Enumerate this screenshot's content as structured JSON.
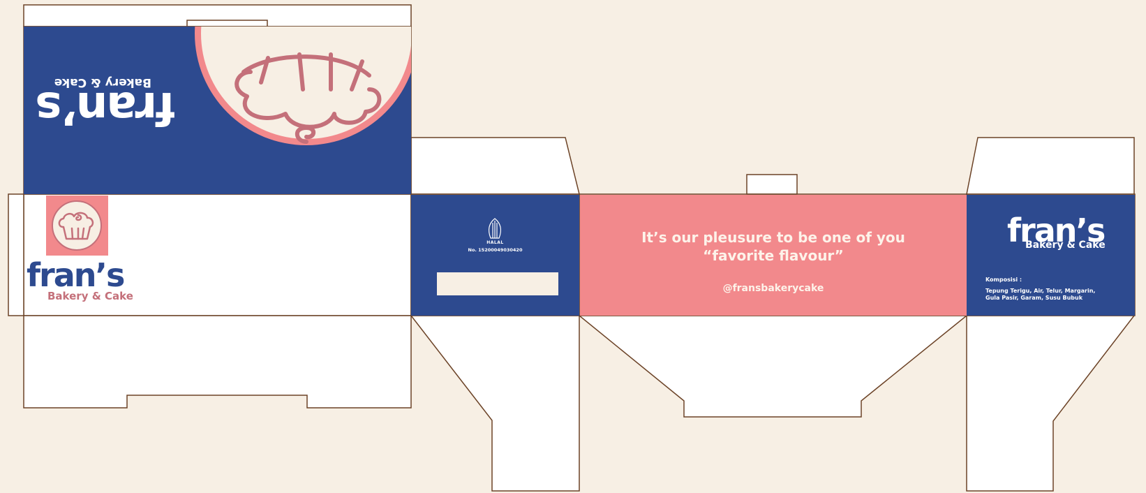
{
  "brand": {
    "name": "fran’s",
    "tagline": "Bakery & Cake"
  },
  "colors": {
    "background": "#f7efe4",
    "navy": "#2d4a8f",
    "pink": "#f2898c",
    "cream": "#f7efe4",
    "mauve": "#c4707a",
    "outline": "#6b4226"
  },
  "side_left": {
    "halal_label": "HALAL",
    "halal_number": "No. 15200049030420"
  },
  "back": {
    "slogan_line1": "It’s our pleusure to be one of you",
    "slogan_line2": "“favorite flavour”",
    "social_handle": "@fransbakerycake"
  },
  "side_right": {
    "composition_title": "Komposisi :",
    "composition_line1": "Tepung Terigu, Air, Telur, Margarin,",
    "composition_line2": "Gula Pasir, Garam, Susu Bubuk"
  },
  "icons": [
    "cupcake-icon",
    "halal-icon",
    "cupcake-illustration"
  ]
}
